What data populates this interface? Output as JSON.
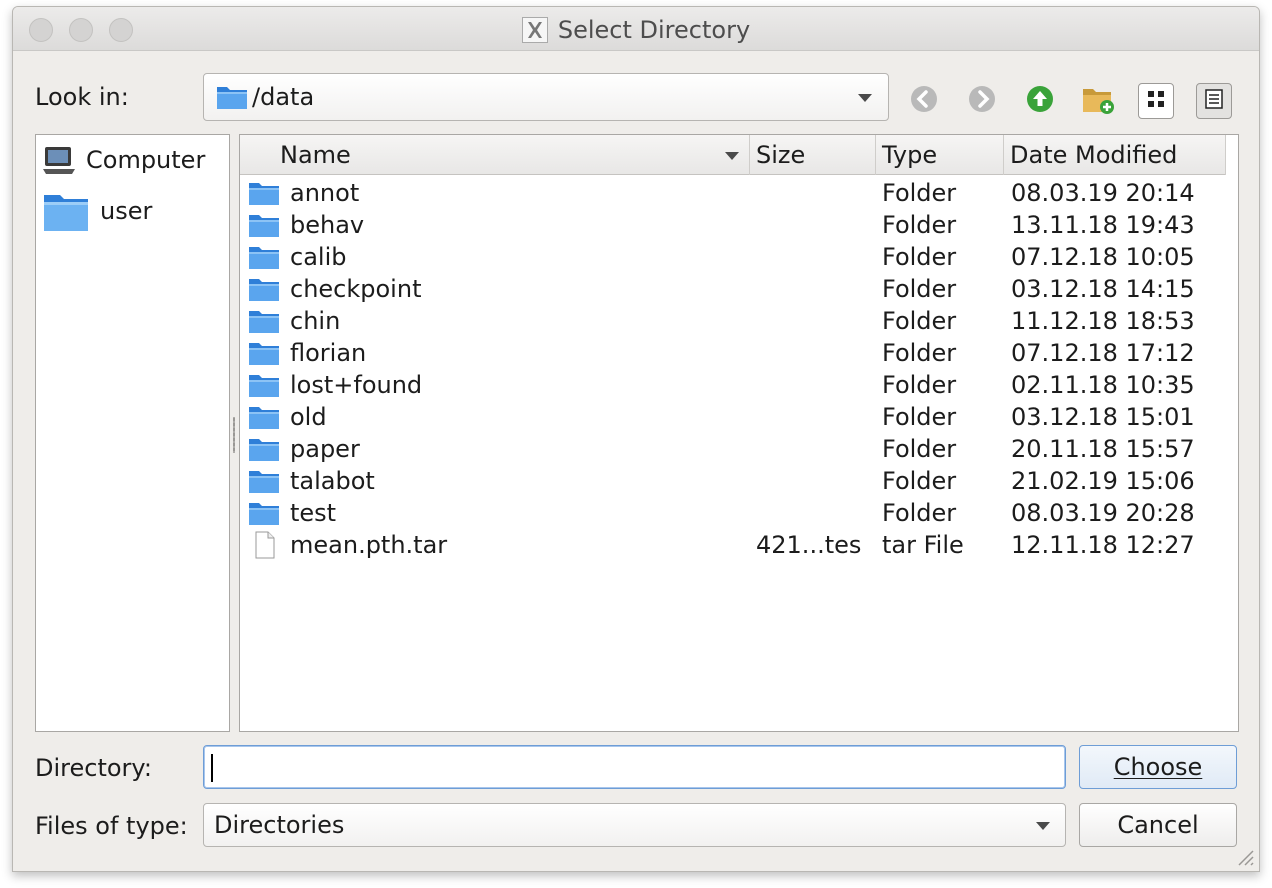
{
  "window": {
    "title": "Select Directory"
  },
  "lookin": {
    "label": "Look in:",
    "path": "/data"
  },
  "toolbar": {
    "buttons": [
      "back-arrow-icon",
      "forward-arrow-icon",
      "parent-directory-icon",
      "new-folder-icon",
      "list-view-icon",
      "detail-view-icon"
    ]
  },
  "sidebar": {
    "items": [
      {
        "label": "Computer",
        "icon": "computer-icon"
      },
      {
        "label": "user",
        "icon": "folder-icon"
      }
    ]
  },
  "files": {
    "columns": [
      "Name",
      "Size",
      "Type",
      "Date Modified"
    ],
    "rows": [
      {
        "name": "annot",
        "size": "",
        "type": "Folder",
        "date": "08.03.19 20:14",
        "icon": "folder"
      },
      {
        "name": "behav",
        "size": "",
        "type": "Folder",
        "date": "13.11.18 19:43",
        "icon": "folder"
      },
      {
        "name": "calib",
        "size": "",
        "type": "Folder",
        "date": "07.12.18 10:05",
        "icon": "folder"
      },
      {
        "name": "checkpoint",
        "size": "",
        "type": "Folder",
        "date": "03.12.18 14:15",
        "icon": "folder"
      },
      {
        "name": "chin",
        "size": "",
        "type": "Folder",
        "date": "11.12.18 18:53",
        "icon": "folder"
      },
      {
        "name": "florian",
        "size": "",
        "type": "Folder",
        "date": "07.12.18 17:12",
        "icon": "folder"
      },
      {
        "name": "lost+found",
        "size": "",
        "type": "Folder",
        "date": "02.11.18 10:35",
        "icon": "folder"
      },
      {
        "name": "old",
        "size": "",
        "type": "Folder",
        "date": "03.12.18 15:01",
        "icon": "folder"
      },
      {
        "name": "paper",
        "size": "",
        "type": "Folder",
        "date": "20.11.18 15:57",
        "icon": "folder"
      },
      {
        "name": "talabot",
        "size": "",
        "type": "Folder",
        "date": "21.02.19 15:06",
        "icon": "folder"
      },
      {
        "name": "test",
        "size": "",
        "type": "Folder",
        "date": "08.03.19 20:28",
        "icon": "folder"
      },
      {
        "name": "mean.pth.tar",
        "size": "421...tes",
        "type": "tar File",
        "date": "12.11.18 12:27",
        "icon": "file"
      }
    ]
  },
  "directory": {
    "label": "Directory:",
    "value": ""
  },
  "filetype": {
    "label": "Files of type:",
    "selected": "Directories"
  },
  "buttons": {
    "choose": "Choose",
    "cancel": "Cancel"
  },
  "colors": {
    "accent": "#6e9dd6",
    "folder": "#3a8ee6",
    "window_bg": "#efedea"
  }
}
